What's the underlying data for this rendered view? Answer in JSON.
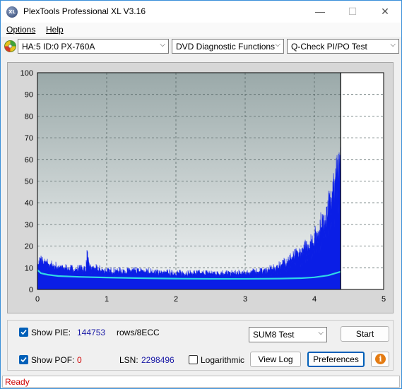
{
  "app": {
    "title": "PlexTools Professional XL V3.16",
    "icon_text": "XL"
  },
  "window_controls": {
    "minimize": "—",
    "maximize": "☐",
    "close": "✕"
  },
  "menu": [
    {
      "label": "Options"
    },
    {
      "label": "Help"
    }
  ],
  "toolbar": {
    "drive": "HA:5 ID:0  PX-760A",
    "function": "DVD Diagnostic Functions",
    "test": "Q-Check PI/PO Test"
  },
  "chart_data": {
    "type": "area",
    "x_ticks": [
      "0",
      "1",
      "2",
      "3",
      "4",
      "5"
    ],
    "y_ticks": [
      "0",
      "10",
      "20",
      "30",
      "40",
      "50",
      "60",
      "70",
      "80",
      "90",
      "100"
    ],
    "xlim": [
      0,
      5
    ],
    "ylim": [
      0,
      100
    ],
    "grid": true,
    "end_marker_x": 4.38,
    "colors": {
      "pie_fill": "#0a1ee6",
      "avg_line": "#2fd6e6",
      "plot_top": "#9aa9a9",
      "plot_bottom": "#f3f5f5",
      "unused": "#ffffff"
    },
    "series": [
      {
        "kind": "pie_profile",
        "x": [
          0,
          0.05,
          0.1,
          0.2,
          0.3,
          0.5,
          0.7,
          0.72,
          0.74,
          1.0,
          1.5,
          2.0,
          2.5,
          3.0,
          3.4,
          3.6,
          3.8,
          4.0,
          4.1,
          4.2,
          4.3,
          4.35,
          4.38
        ],
        "y": [
          12,
          15,
          13,
          12,
          11,
          10,
          10,
          20,
          11,
          9,
          9,
          8,
          8,
          8,
          10,
          14,
          18,
          25,
          32,
          40,
          52,
          62,
          66
        ]
      },
      {
        "kind": "average",
        "x": [
          0,
          0.05,
          0.15,
          0.3,
          0.6,
          1.0,
          1.5,
          2.0,
          2.5,
          3.0,
          3.5,
          3.8,
          4.0,
          4.2,
          4.38
        ],
        "y": [
          9,
          7.5,
          6.8,
          6.2,
          5.8,
          5.5,
          5.2,
          5.0,
          4.9,
          4.9,
          5.0,
          5.2,
          5.6,
          6.5,
          8.2
        ]
      }
    ]
  },
  "bottom": {
    "show_pie_label": "Show PIE:",
    "pie_value": "144753",
    "pie_unit": "rows/8ECC",
    "show_pof_label": "Show POF:",
    "pof_value": "0",
    "lsn_label": "LSN:",
    "lsn_value": "2298496",
    "logarithmic_label": "Logarithmic",
    "sum_select": "SUM8 Test",
    "start_label": "Start",
    "view_log_label": "View Log",
    "preferences_label": "Preferences"
  },
  "status": {
    "text": "Ready"
  }
}
